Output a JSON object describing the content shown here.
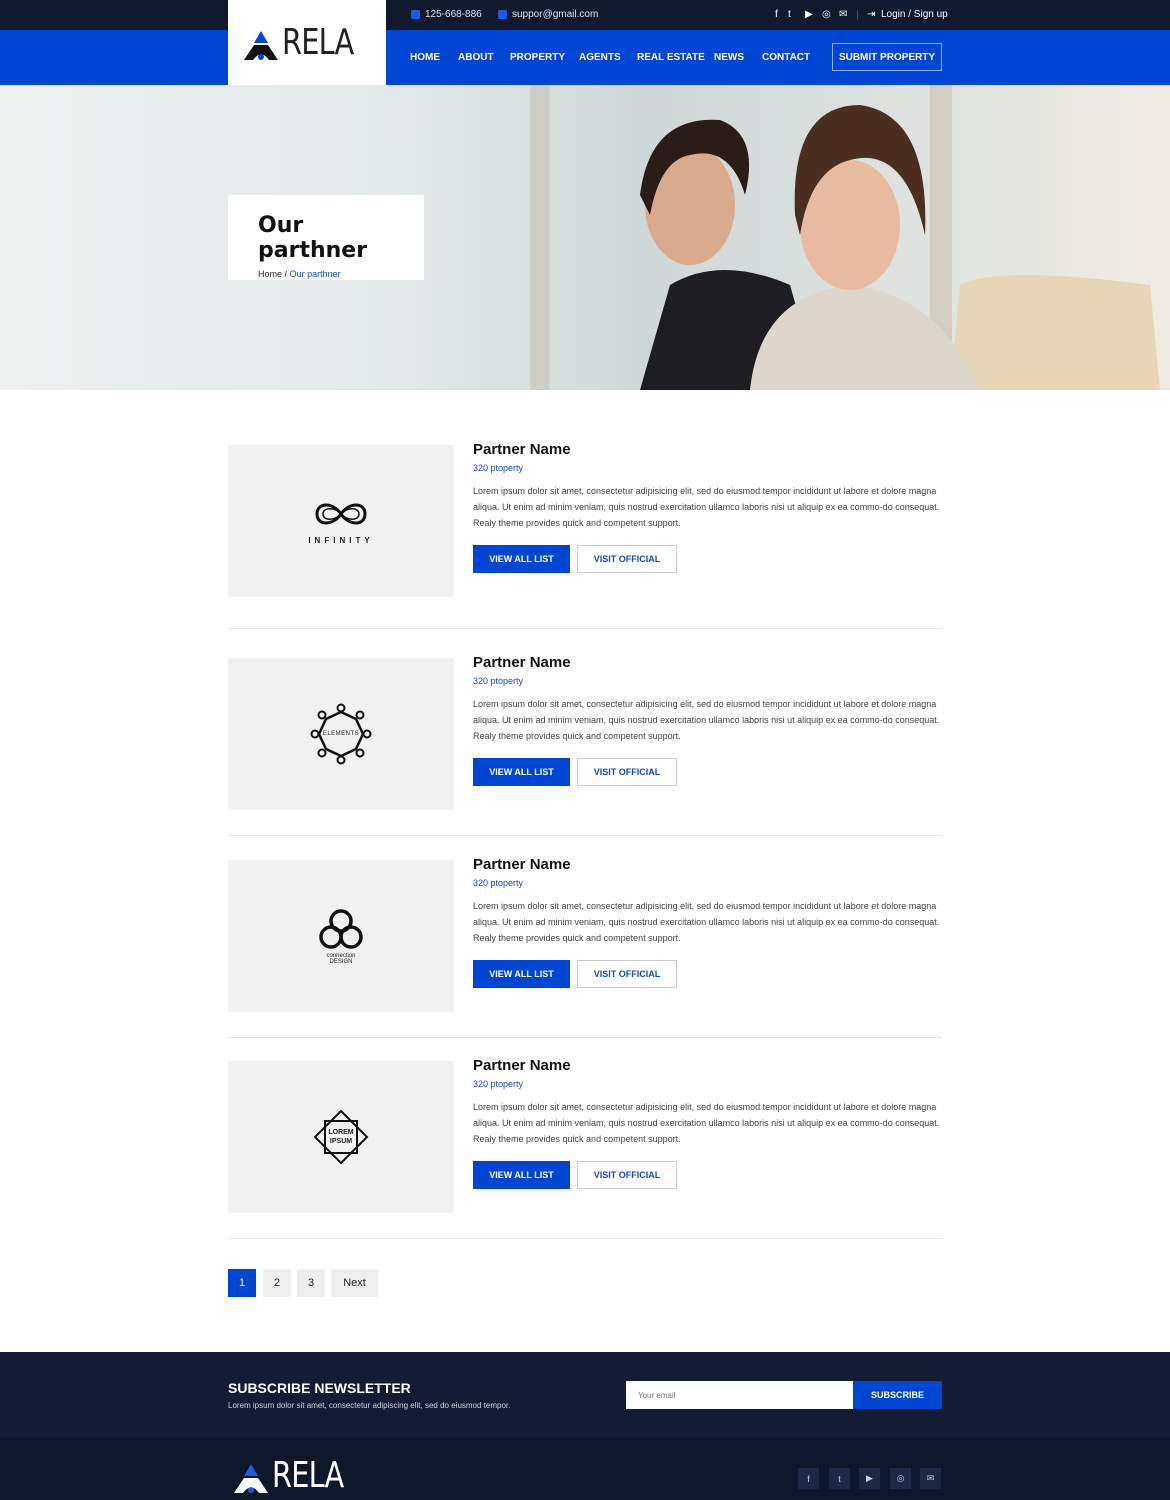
{
  "brand": {
    "name": "RELA"
  },
  "topbar": {
    "phone": "125-668-886",
    "email": "suppor@gmail.com",
    "login": "Login / Sign up",
    "social": [
      "facebook-icon",
      "twitter-icon",
      "youtube-icon",
      "instagram-icon",
      "mail-icon"
    ]
  },
  "nav": {
    "items": [
      "HOME",
      "ABOUT",
      "PROPERTY",
      "AGENTS",
      "REAL ESTATE",
      "NEWS",
      "CONTACT"
    ],
    "submit": "SUBMIT PROPERTY"
  },
  "hero": {
    "title": "Our parthner",
    "breadcrumb": {
      "home": "Home",
      "sep": "/",
      "current": "Our parthner"
    }
  },
  "partners": [
    {
      "name": "Partner Name",
      "count": "320 ptoperty",
      "logo": "INFINITY",
      "desc": "Lorem ipsum dolor sit amet, consectetur adipisicing elit, sed do eiusmod tempor incididunt ut labore et dolore magna aliqua. Ut enim ad minim veniam, quis nostrud exercitation ullamco laboris nisi ut aliquip ex ea commo-do consequat. Realy theme provides quick and competent support.",
      "view": "VIEW ALL LIST",
      "visit": "VISIT OFFICIAL"
    },
    {
      "name": "Partner Name",
      "count": "320 ptoperty",
      "logo": "ELEMENTS",
      "desc": "Lorem ipsum dolor sit amet, consectetur adipisicing elit, sed do eiusmod tempor incididunt ut labore et dolore magna aliqua. Ut enim ad minim veniam, quis nostrud exercitation ullamco laboris nisi ut aliquip ex ea commo-do consequat. Realy theme provides quick and competent support.",
      "view": "VIEW ALL LIST",
      "visit": "VISIT OFFICIAL"
    },
    {
      "name": "Partner Name",
      "count": "320 ptoperty",
      "logo": "connection DESIGN",
      "desc": "Lorem ipsum dolor sit amet, consectetur adipisicing elit, sed do eiusmod tempor incididunt ut labore et dolore magna aliqua. Ut enim ad minim veniam, quis nostrud exercitation ullamco laboris nisi ut aliquip ex ea commo-do consequat. Realy theme provides quick and competent support.",
      "view": "VIEW ALL LIST",
      "visit": "VISIT OFFICIAL"
    },
    {
      "name": "Partner Name",
      "count": "320 ptoperty",
      "logo": "LOREM IPSUM",
      "desc": "Lorem ipsum dolor sit amet, consectetur adipisicing elit, sed do eiusmod tempor incididunt ut labore et dolore magna aliqua. Ut enim ad minim veniam, quis nostrud exercitation ullamco laboris nisi ut aliquip ex ea commo-do consequat. Realy theme provides quick and competent support.",
      "view": "VIEW ALL LIST",
      "visit": "VISIT OFFICIAL"
    }
  ],
  "pagination": {
    "pages": [
      "1",
      "2",
      "3"
    ],
    "next": "Next",
    "active": "1"
  },
  "newsletter": {
    "title": "SUBSCRIBE NEWSLETTER",
    "text": "Lorem ipsum dolor sit amet, consectetur adipiscing elit, sed do eiusmod tempor.",
    "placeholder": "Your email",
    "button": "SUBSCRIBE"
  },
  "colors": {
    "primary": "#0046d5",
    "dark": "#121a2e"
  }
}
